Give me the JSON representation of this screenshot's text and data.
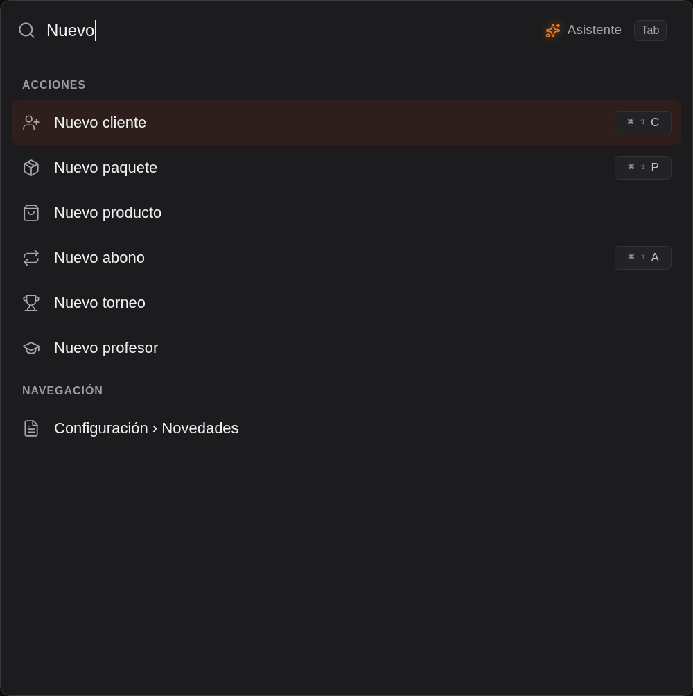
{
  "search": {
    "value": "Nuevo"
  },
  "assistant": {
    "label": "Asistente",
    "shortcut": "Tab"
  },
  "sections": [
    {
      "title": "ACCIONES",
      "items": [
        {
          "label": "Nuevo cliente",
          "selected": true,
          "shortcut": [
            "⌘",
            "⇧",
            "C"
          ]
        },
        {
          "label": "Nuevo paquete",
          "selected": false,
          "shortcut": [
            "⌘",
            "⇧",
            "P"
          ]
        },
        {
          "label": "Nuevo producto",
          "selected": false
        },
        {
          "label": "Nuevo abono",
          "selected": false,
          "shortcut": [
            "⌘",
            "⇧",
            "A"
          ]
        },
        {
          "label": "Nuevo torneo",
          "selected": false
        },
        {
          "label": "Nuevo profesor",
          "selected": false
        }
      ]
    },
    {
      "title": "NAVEGACIÓN",
      "items": [
        {
          "label": "Configuración › Novedades",
          "selected": false
        }
      ]
    }
  ]
}
